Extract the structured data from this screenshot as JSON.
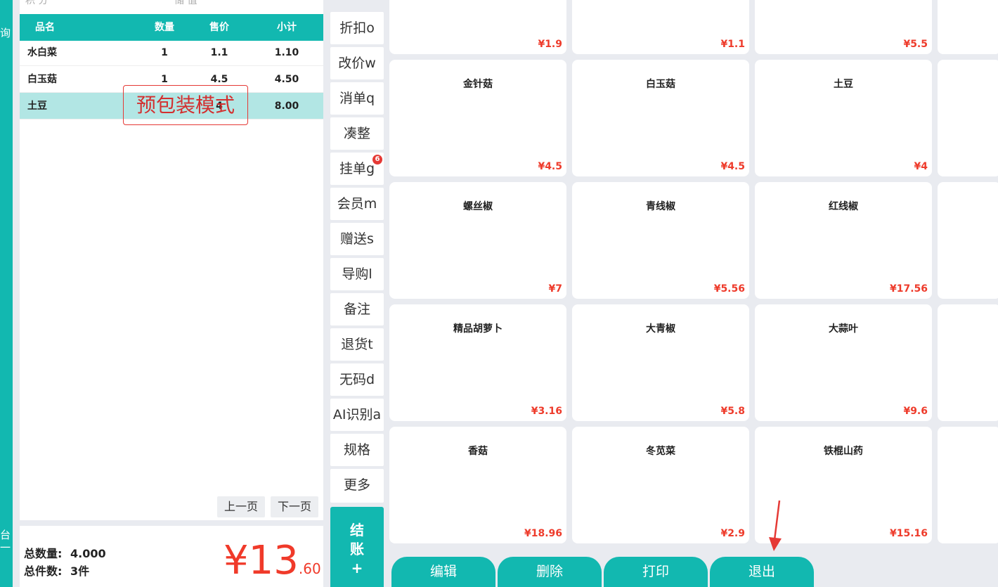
{
  "side_strip": {
    "top_text": "询",
    "bottom_text": "台 一"
  },
  "top_hint": {
    "left": "积 分",
    "right": "储 值"
  },
  "order_table": {
    "headers": {
      "name": "品名",
      "qty": "数量",
      "price": "售价",
      "subtotal": "小计"
    },
    "rows": [
      {
        "name": "水白菜",
        "qty": "1",
        "price": "1.1",
        "subtotal": "1.10"
      },
      {
        "name": "白玉菇",
        "qty": "1",
        "price": "4.5",
        "subtotal": "4.50"
      },
      {
        "name": "土豆",
        "qty": "",
        "price": "4",
        "subtotal": "8.00"
      }
    ]
  },
  "mode_label": "预包装模式",
  "pagination": {
    "prev": "上一页",
    "next": "下一页"
  },
  "summary": {
    "total_qty_label": "总数量:",
    "total_qty": "4.000",
    "total_items_label": "总件数:",
    "total_items": "3件",
    "currency": "¥",
    "amount_main": "13",
    "amount_cents": ".60"
  },
  "functions": [
    {
      "label": "折扣o"
    },
    {
      "label": "改价w"
    },
    {
      "label": "消单q"
    },
    {
      "label": "凑整"
    },
    {
      "label": "挂单g",
      "badge": "6"
    },
    {
      "label": "会员m"
    },
    {
      "label": "赠送s"
    },
    {
      "label": "导购l"
    },
    {
      "label": "备注"
    },
    {
      "label": "退货t"
    },
    {
      "label": "无码d"
    },
    {
      "label": "AI识别a"
    },
    {
      "label": "规格"
    },
    {
      "label": "更多"
    }
  ],
  "checkout": {
    "line1": "结",
    "line2": "账",
    "line3": "+"
  },
  "products": [
    {
      "name": "",
      "price": "¥1.9"
    },
    {
      "name": "",
      "price": "¥1.1"
    },
    {
      "name": "",
      "price": "¥5.5"
    },
    {
      "name": "金针菇",
      "price": "¥4.5"
    },
    {
      "name": "白玉菇",
      "price": "¥4.5"
    },
    {
      "name": "土豆",
      "price": "¥4"
    },
    {
      "name": "螺丝椒",
      "price": "¥7"
    },
    {
      "name": "青线椒",
      "price": "¥5.56"
    },
    {
      "name": "红线椒",
      "price": "¥17.56"
    },
    {
      "name": "精品胡萝卜",
      "price": "¥3.16"
    },
    {
      "name": "大青椒",
      "price": "¥5.8"
    },
    {
      "name": "大蒜叶",
      "price": "¥9.6"
    },
    {
      "name": "香菇",
      "price": "¥18.96"
    },
    {
      "name": "冬苋菜",
      "price": "¥2.9"
    },
    {
      "name": "铁棍山药",
      "price": "¥15.16"
    }
  ],
  "bottom_actions": {
    "edit": "编辑",
    "delete": "删除",
    "print": "打印",
    "exit": "退出"
  },
  "colors": {
    "accent": "#12b8b0",
    "price": "#ee3b2b",
    "selected_row": "#b2e6e4",
    "annotation": "#e53935"
  }
}
